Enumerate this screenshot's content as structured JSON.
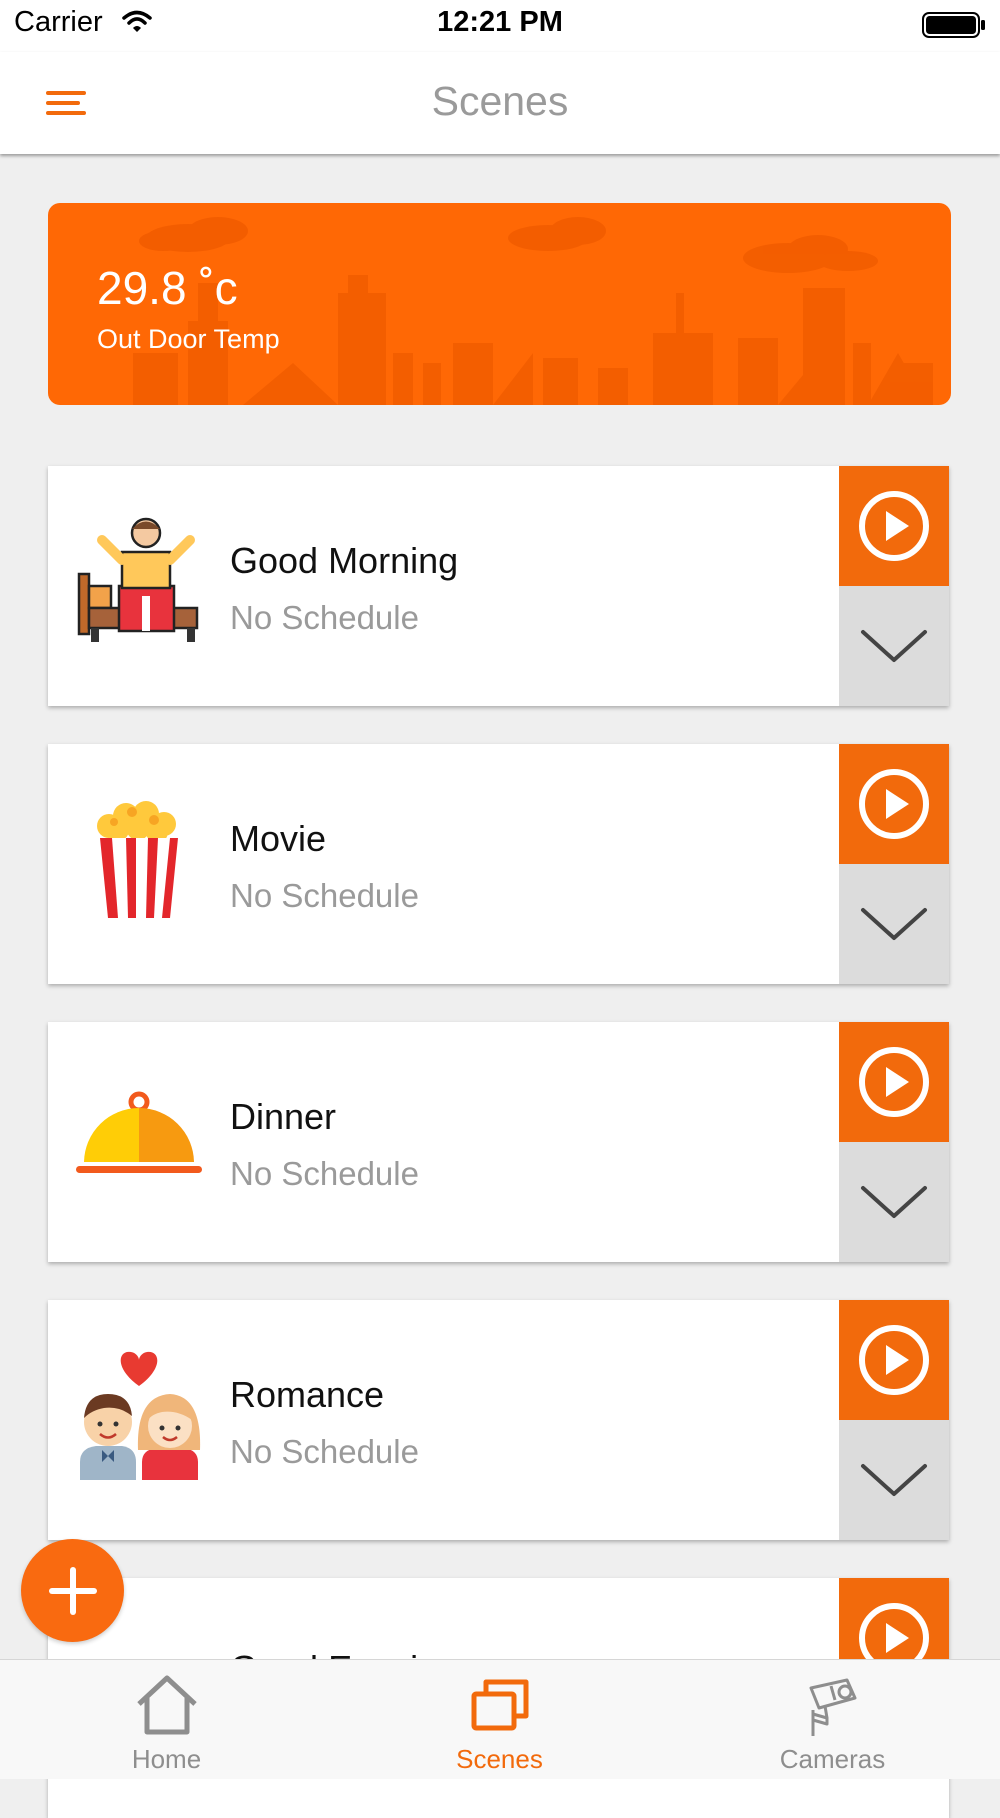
{
  "status_bar": {
    "carrier": "Carrier",
    "time": "12:21 PM"
  },
  "header": {
    "title": "Scenes"
  },
  "weather": {
    "temperature": "29.8 ˚c",
    "label": "Out Door Temp"
  },
  "scenes": [
    {
      "name": "Good Morning",
      "schedule": "No Schedule",
      "icon": "wake-up-bed-icon"
    },
    {
      "name": "Movie",
      "schedule": "No Schedule",
      "icon": "popcorn-icon"
    },
    {
      "name": "Dinner",
      "schedule": "No Schedule",
      "icon": "food-cloche-icon"
    },
    {
      "name": "Romance",
      "schedule": "No Schedule",
      "icon": "couple-heart-icon"
    },
    {
      "name": "Good Evening",
      "schedule": "",
      "icon": "evening-icon"
    }
  ],
  "tabs": [
    {
      "label": "Home",
      "icon": "home-icon",
      "active": false
    },
    {
      "label": "Scenes",
      "icon": "scenes-icon",
      "active": true
    },
    {
      "label": "Cameras",
      "icon": "camera-icon",
      "active": false
    }
  ],
  "colors": {
    "accent": "#f26a0c",
    "weather_card": "#ff6805",
    "inactive": "#8e8e8e"
  }
}
